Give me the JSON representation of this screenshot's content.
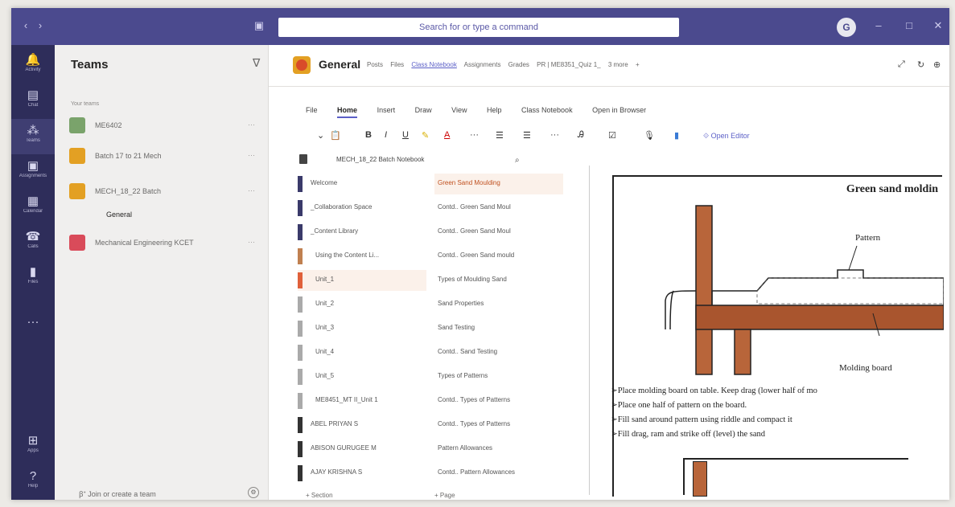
{
  "titlebar": {
    "search_placeholder": "Search for or type a command"
  },
  "rail": [
    {
      "label": "Activity",
      "icon": "bell-icon"
    },
    {
      "label": "Chat",
      "icon": "chat-icon"
    },
    {
      "label": "Teams",
      "icon": "teams-icon"
    },
    {
      "label": "Assignments",
      "icon": "assignments-icon"
    },
    {
      "label": "Calendar",
      "icon": "calendar-icon"
    },
    {
      "label": "Calls",
      "icon": "phone-icon"
    },
    {
      "label": "Files",
      "icon": "file-icon"
    },
    {
      "label": "Apps",
      "icon": "apps-icon"
    },
    {
      "label": "Help",
      "icon": "help-icon"
    }
  ],
  "teams_panel": {
    "title": "Teams",
    "your_teams": "Your teams",
    "teams": [
      {
        "name": "ME6402",
        "color": "#7aa36b"
      },
      {
        "name": "Batch 17 to 21 Mech",
        "color": "#e3a023"
      },
      {
        "name": "MECH_18_22 Batch",
        "color": "#e3a023"
      },
      {
        "name": "Mechanical Engineering KCET",
        "color": "#d94b5a"
      }
    ],
    "channel": "General",
    "join_label": "Join or create a team"
  },
  "channel": {
    "name": "General",
    "tabs": [
      "Posts",
      "Files",
      "Class Notebook",
      "Assignments",
      "Grades",
      "PR | ME8351_Quiz 1_",
      "3 more"
    ],
    "active_tab": "Class Notebook"
  },
  "ribbon": {
    "tabs": [
      "File",
      "Home",
      "Insert",
      "Draw",
      "View",
      "Help",
      "Class Notebook",
      "Open in Browser"
    ],
    "active": "Home",
    "open_editor": "Open Editor"
  },
  "notebook": {
    "name": "MECH_18_22 Batch Notebook",
    "sections": [
      {
        "label": "Welcome",
        "color": "#3a3a6a"
      },
      {
        "label": "_Collaboration Space",
        "color": "#3a3a6a"
      },
      {
        "label": "_Content Library",
        "color": "#3a3a6a"
      },
      {
        "label": "Using the Content Li...",
        "color": "#c08050"
      },
      {
        "label": "Unit_1",
        "color": "#e0603a"
      },
      {
        "label": "Unit_2",
        "color": "#aaaaaa"
      },
      {
        "label": "Unit_3",
        "color": "#aaaaaa"
      },
      {
        "label": "Unit_4",
        "color": "#aaaaaa"
      },
      {
        "label": "Unit_5",
        "color": "#aaaaaa"
      },
      {
        "label": "ME8451_MT II_Unit 1",
        "color": "#aaaaaa"
      },
      {
        "label": "ABEL PRIYAN S",
        "color": "#333333"
      },
      {
        "label": "ABISON GURUGEE M",
        "color": "#333333"
      },
      {
        "label": "AJAY KRISHNA S",
        "color": "#333333"
      }
    ],
    "pages": [
      "Green Sand Moulding",
      "Contd.. Green Sand Moul",
      "Contd.. Green Sand Moul",
      "Contd.. Green Sand mould",
      "Types of Moulding Sand",
      "Sand Properties",
      "Sand Testing",
      "Contd.. Sand Testing",
      "Types of Patterns",
      "Contd.. Types of Patterns",
      "Contd.. Types of Patterns",
      "Pattern Allowances",
      "Contd.. Pattern Allowances"
    ],
    "add_section": "+ Section",
    "add_page": "+ Page"
  },
  "document": {
    "title": "Green sand moldin",
    "label_pattern": "Pattern",
    "label_board": "Molding board",
    "bullets": [
      "➢Place molding board on table. Keep drag (lower half of mo",
      "➢Place one half of pattern on the board.",
      "➢Fill sand around pattern using riddle and compact it",
      "➢Fill drag, ram and strike off (level) the sand"
    ]
  }
}
